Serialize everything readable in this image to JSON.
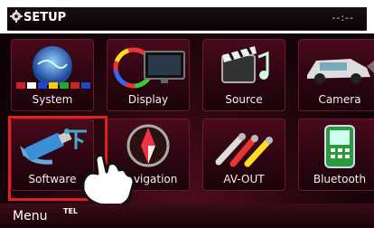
{
  "header": {
    "title": "SETUP",
    "clock": "--:--"
  },
  "tiles": [
    {
      "label": "System"
    },
    {
      "label": "Display"
    },
    {
      "label": "Source"
    },
    {
      "label": "Camera"
    },
    {
      "label": "Software"
    },
    {
      "label": "Navigation"
    },
    {
      "label": "AV-OUT"
    },
    {
      "label": "Bluetooth"
    }
  ],
  "footer": {
    "menu": "Menu",
    "tel": "TEL"
  },
  "colors": {
    "accent": "#e0201e",
    "tile": "#4a0a1c"
  },
  "icons": [
    "gear-icon",
    "globe-icon",
    "monitor-icon",
    "film-music-icon",
    "car-camera-icon",
    "usb-drive-icon",
    "compass-icon",
    "rca-plug-icon",
    "phone-icon",
    "pointing-hand-icon"
  ]
}
